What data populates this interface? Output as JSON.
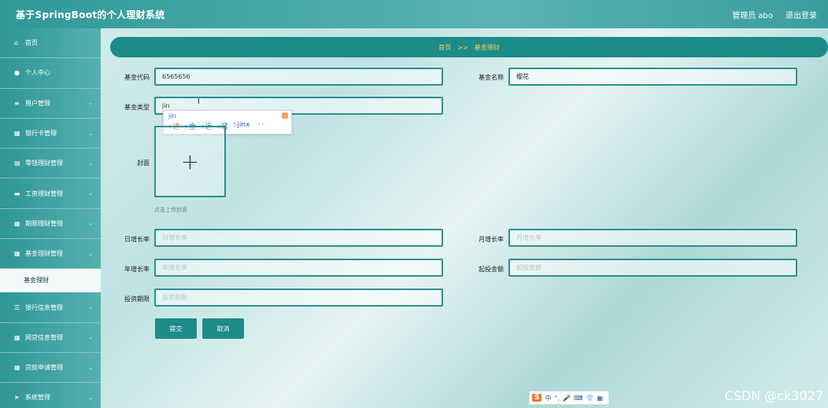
{
  "header": {
    "title": "基于SpringBoot的个人理财系统",
    "user": "管理员 abo",
    "logout": "退出登录"
  },
  "sidebar": {
    "items": [
      {
        "label": "首页",
        "icon": "home-icon",
        "glyph": "⌂"
      },
      {
        "label": "个人中心",
        "icon": "user-icon",
        "glyph": "●"
      },
      {
        "label": "用户管理",
        "icon": "sliders-icon",
        "glyph": "≡"
      },
      {
        "label": "银行卡管理",
        "icon": "grid-icon",
        "glyph": "▦"
      },
      {
        "label": "零钱理财管理",
        "icon": "clipboard-icon",
        "glyph": "▤"
      },
      {
        "label": "工资理财管理",
        "icon": "card-icon",
        "glyph": "▬"
      },
      {
        "label": "期限理财管理",
        "icon": "grid-icon",
        "glyph": "▦"
      },
      {
        "label": "基金理财管理",
        "icon": "grid-icon",
        "glyph": "▦"
      },
      {
        "label": "基金理财",
        "sub": true
      },
      {
        "label": "银行信息管理",
        "icon": "list-icon",
        "glyph": "☰"
      },
      {
        "label": "网贷信息管理",
        "icon": "grid-icon",
        "glyph": "▦"
      },
      {
        "label": "贷款申请管理",
        "icon": "grid-icon",
        "glyph": "▦"
      },
      {
        "label": "系统管理",
        "icon": "send-icon",
        "glyph": "➤"
      }
    ]
  },
  "breadcrumb": {
    "home": "首页",
    "sep": ">>",
    "current": "基金理财"
  },
  "form": {
    "fund_code_label": "基金代码",
    "fund_code_value": "6565656",
    "fund_name_label": "基金名称",
    "fund_name_value": "樱花",
    "fund_type_label": "基金类型",
    "fund_type_value": "jin",
    "cover_label": "封面",
    "upload_hint": "点击上传封面",
    "daily_growth_label": "日增长率",
    "daily_growth_placeholder": "日增长率",
    "monthly_growth_label": "月增长率",
    "monthly_growth_placeholder": "月增长率",
    "yearly_growth_label": "年增长率",
    "yearly_growth_placeholder": "年增长率",
    "min_amount_label": "起投金额",
    "min_amount_placeholder": "起投金额",
    "term_label": "投资期限",
    "term_placeholder": "投资期限",
    "submit": "提交",
    "cancel": "取消"
  },
  "ime": {
    "pinyin": "jin",
    "candidates": [
      {
        "n": "1",
        "text": "进"
      },
      {
        "n": "2",
        "text": "金"
      },
      {
        "n": "3",
        "text": "近"
      },
      {
        "n": "4",
        "text": "紧"
      },
      {
        "n": "5",
        "text": "jinx"
      }
    ],
    "toolbar": [
      "S",
      "中",
      "°,",
      "🎤",
      "⌨",
      "👕",
      "▦"
    ]
  },
  "watermark": "CSDN @ck3027"
}
